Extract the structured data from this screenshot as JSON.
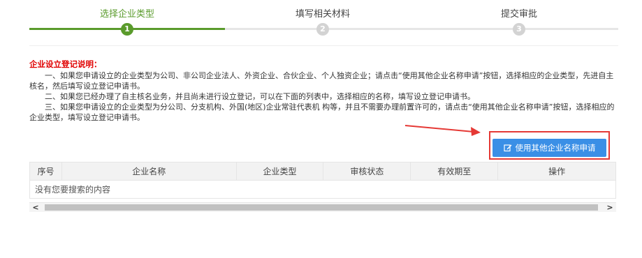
{
  "stepper": {
    "steps": [
      {
        "label": "选择企业类型",
        "number": "1",
        "state": "active"
      },
      {
        "label": "填写相关材料",
        "number": "2",
        "state": "pending"
      },
      {
        "label": "提交审批",
        "number": "3",
        "state": "pending"
      }
    ]
  },
  "notes": {
    "title": "企业设立登记说明：",
    "items": [
      "一、如果您申请设立的企业类型为公司、非公司企业法人、外资企业、合伙企业、个人独资企业；请点击“使用其他企业名称申请”按钮，选择相应的企业类型，先进自主核名，然后填写设立登记申请书。",
      "二、如果您已经办理了自主核名业务，并且尚未进行设立登记，可以在下面的列表中，选择相应的名称，填写设立登记申请书。",
      "三、如果您申请设立的企业类型为分公司、分支机构、外国(地区)企业常驻代表机 构等，并且不需要办理前置许可的，请点击“使用其他企业名称申请”按钮，选择相应的企业类型，填写设立登记申请书。"
    ]
  },
  "actions": {
    "other_name_button": "使用其他企业名称申请",
    "other_name_icon": "edit-icon"
  },
  "table": {
    "headers": [
      "序号",
      "企业名称",
      "企业类型",
      "审核状态",
      "有效期至",
      "操作"
    ],
    "empty_text": "没有您要搜索的内容"
  },
  "scrollbar": {
    "left_arrow": "<",
    "right_arrow": ">"
  },
  "colors": {
    "active_green": "#5a9b2c",
    "pending_gray": "#d3d3d3",
    "notes_title_red": "#e00000",
    "primary_blue": "#3a8fe6",
    "highlight_red": "#e53935"
  }
}
